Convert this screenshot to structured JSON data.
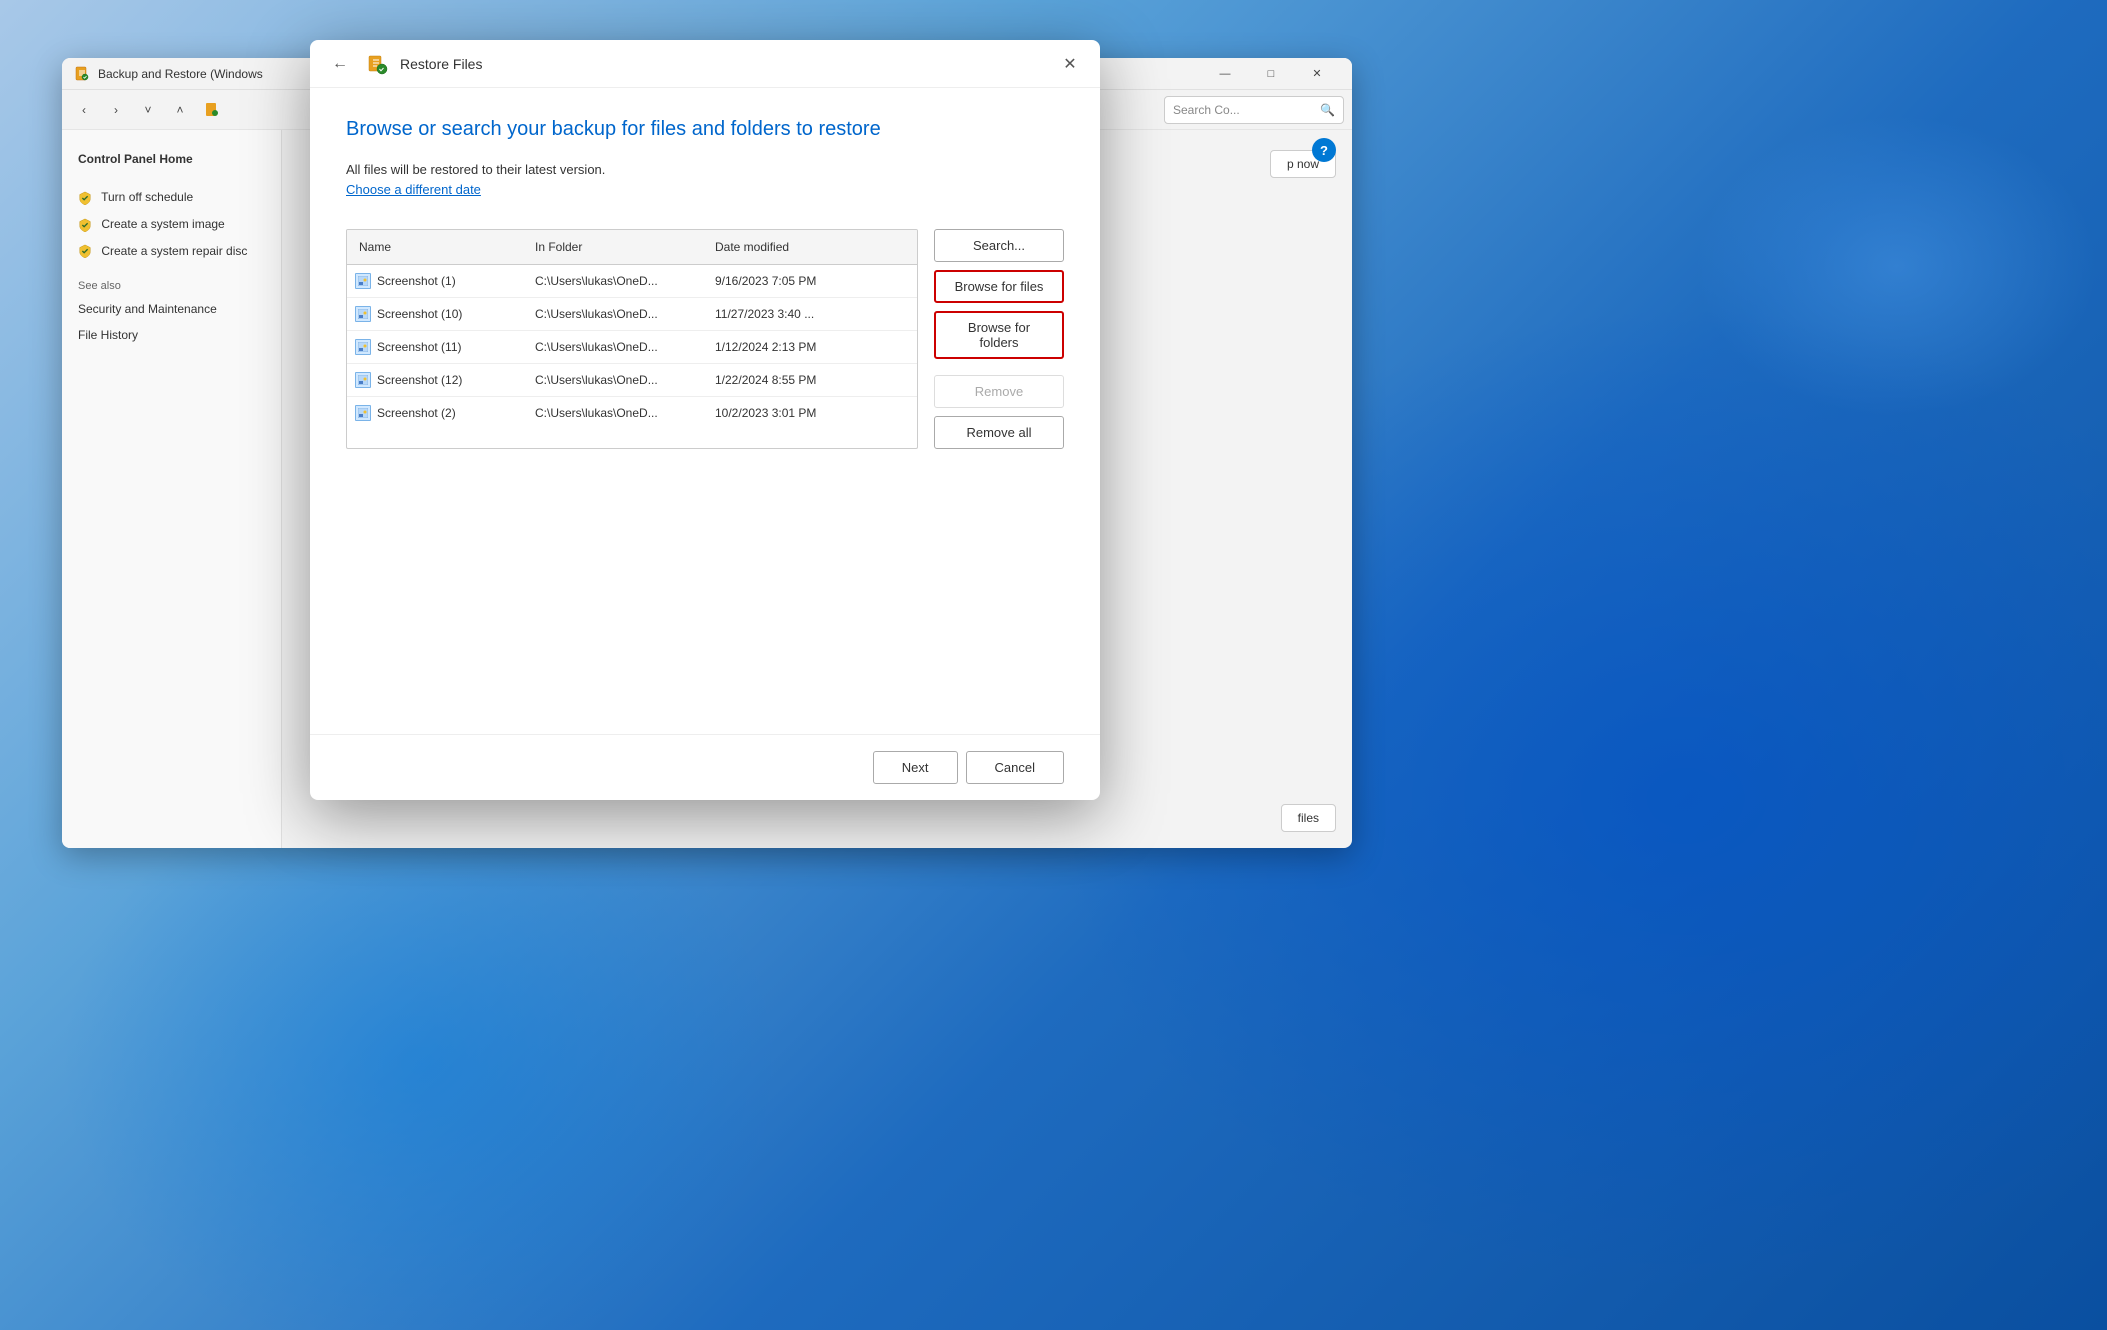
{
  "desktop": {
    "bg_description": "Windows 11 blue wallpaper"
  },
  "bg_window": {
    "title": "Backup and Restore (Windows",
    "controls": {
      "minimize": "—",
      "maximize": "□",
      "close": "✕"
    },
    "toolbar": {
      "back": "‹",
      "forward": "›",
      "down": "˅",
      "up": "˄",
      "search_placeholder": "Search Co...",
      "search_icon": "🔍"
    },
    "sidebar": {
      "items": [
        {
          "label": "Control Panel Home",
          "bold": true
        },
        {
          "label": "Turn off schedule",
          "icon": "shield"
        },
        {
          "label": "Create a system image",
          "icon": "shield"
        },
        {
          "label": "Create a system repair disc",
          "icon": "shield"
        }
      ],
      "see_also_label": "See also",
      "see_also_items": [
        {
          "label": "Security and Maintenance"
        },
        {
          "label": "File History"
        }
      ]
    },
    "main": {
      "action_btn": "p now",
      "bottom_btn": "files",
      "help_btn": "?"
    }
  },
  "dialog": {
    "titlebar": {
      "back_btn": "←",
      "title": "Restore Files",
      "close_btn": "✕"
    },
    "heading": "Browse or search your backup for files and folders to restore",
    "subtext": "All files will be restored to their latest version.",
    "link": "Choose a different date",
    "table": {
      "columns": [
        "Name",
        "In Folder",
        "Date modified"
      ],
      "rows": [
        {
          "name": "Screenshot (1)",
          "folder": "C:\\Users\\lukas\\OneD...",
          "date": "9/16/2023 7:05 PM"
        },
        {
          "name": "Screenshot (10)",
          "folder": "C:\\Users\\lukas\\OneD...",
          "date": "11/27/2023 3:40 ..."
        },
        {
          "name": "Screenshot (11)",
          "folder": "C:\\Users\\lukas\\OneD...",
          "date": "1/12/2024 2:13 PM"
        },
        {
          "name": "Screenshot (12)",
          "folder": "C:\\Users\\lukas\\OneD...",
          "date": "1/22/2024 8:55 PM"
        },
        {
          "name": "Screenshot (2)",
          "folder": "C:\\Users\\lukas\\OneD...",
          "date": "10/2/2023 3:01 PM"
        }
      ]
    },
    "buttons": {
      "search": "Search...",
      "browse_files": "Browse for files",
      "browse_folders": "Browse for folders",
      "remove": "Remove",
      "remove_all": "Remove all"
    },
    "footer": {
      "next": "Next",
      "cancel": "Cancel"
    }
  }
}
